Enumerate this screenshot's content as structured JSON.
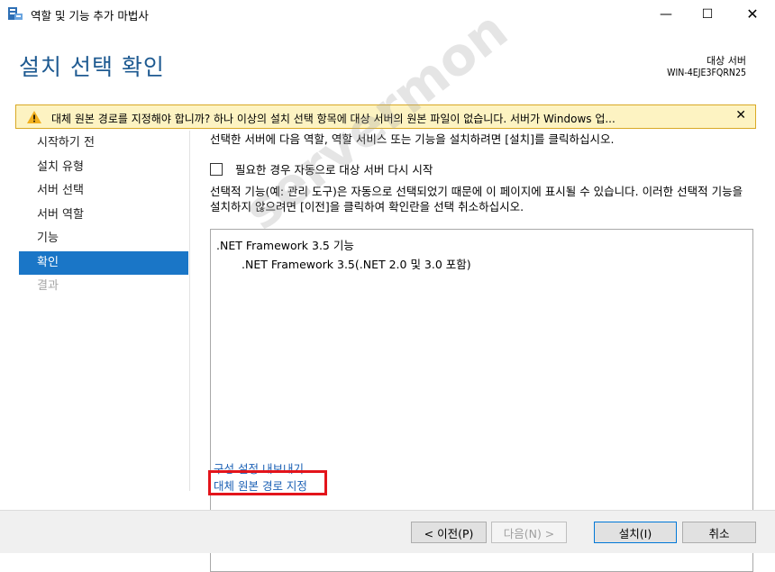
{
  "window": {
    "title": "역할 및 기능 추가 마법사",
    "controls": {
      "minimize": "—",
      "maximize": "☐",
      "close": "✕"
    }
  },
  "header": {
    "page_title": "설치 선택 확인",
    "dest_label": "대상 서버",
    "dest_name": "WIN-4EJE3FQRN25"
  },
  "warning": {
    "text": "대체 원본 경로를 지정해야 합니까? 하나 이상의 설치 선택 항목에 대상 서버의 원본 파일이 없습니다. 서버가 Windows 업...",
    "close": "✕",
    "color": "#fdf3c2"
  },
  "sidebar": {
    "items": [
      {
        "label": "시작하기 전"
      },
      {
        "label": "설치 유형"
      },
      {
        "label": "서버 선택"
      },
      {
        "label": "서버 역할"
      },
      {
        "label": "기능"
      },
      {
        "label": "확인"
      },
      {
        "label": "결과"
      }
    ],
    "active_index": 5,
    "accent_color": "#1a76c7"
  },
  "content": {
    "intro": "선택한 서버에 다음 역할, 역할 서비스 또는 기능을 설치하려면 [설치]를 클릭하십시오.",
    "restart_checkbox_label": "필요한 경우 자동으로 대상 서버 다시 시작",
    "restart_checked": false,
    "description": "선택적 기능(예: 관리 도구)은 자동으로 선택되었기 때문에 이 페이지에 표시될 수 있습니다. 이러한 선택적 기능을 설치하지 않으려면 [이전]을 클릭하여 확인란을 선택 취소하십시오.",
    "selections": [
      ".NET Framework 3.5 기능",
      ".NET Framework 3.5(.NET 2.0 및 3.0 포함)"
    ],
    "links": {
      "export": "구성 설정 내보내기",
      "alternate_source": "대체 원본 경로 지정"
    }
  },
  "footer": {
    "prev": "< 이전(P)",
    "next": "다음(N) >",
    "install": "설치(I)",
    "cancel": "취소"
  },
  "watermark": "servermon"
}
